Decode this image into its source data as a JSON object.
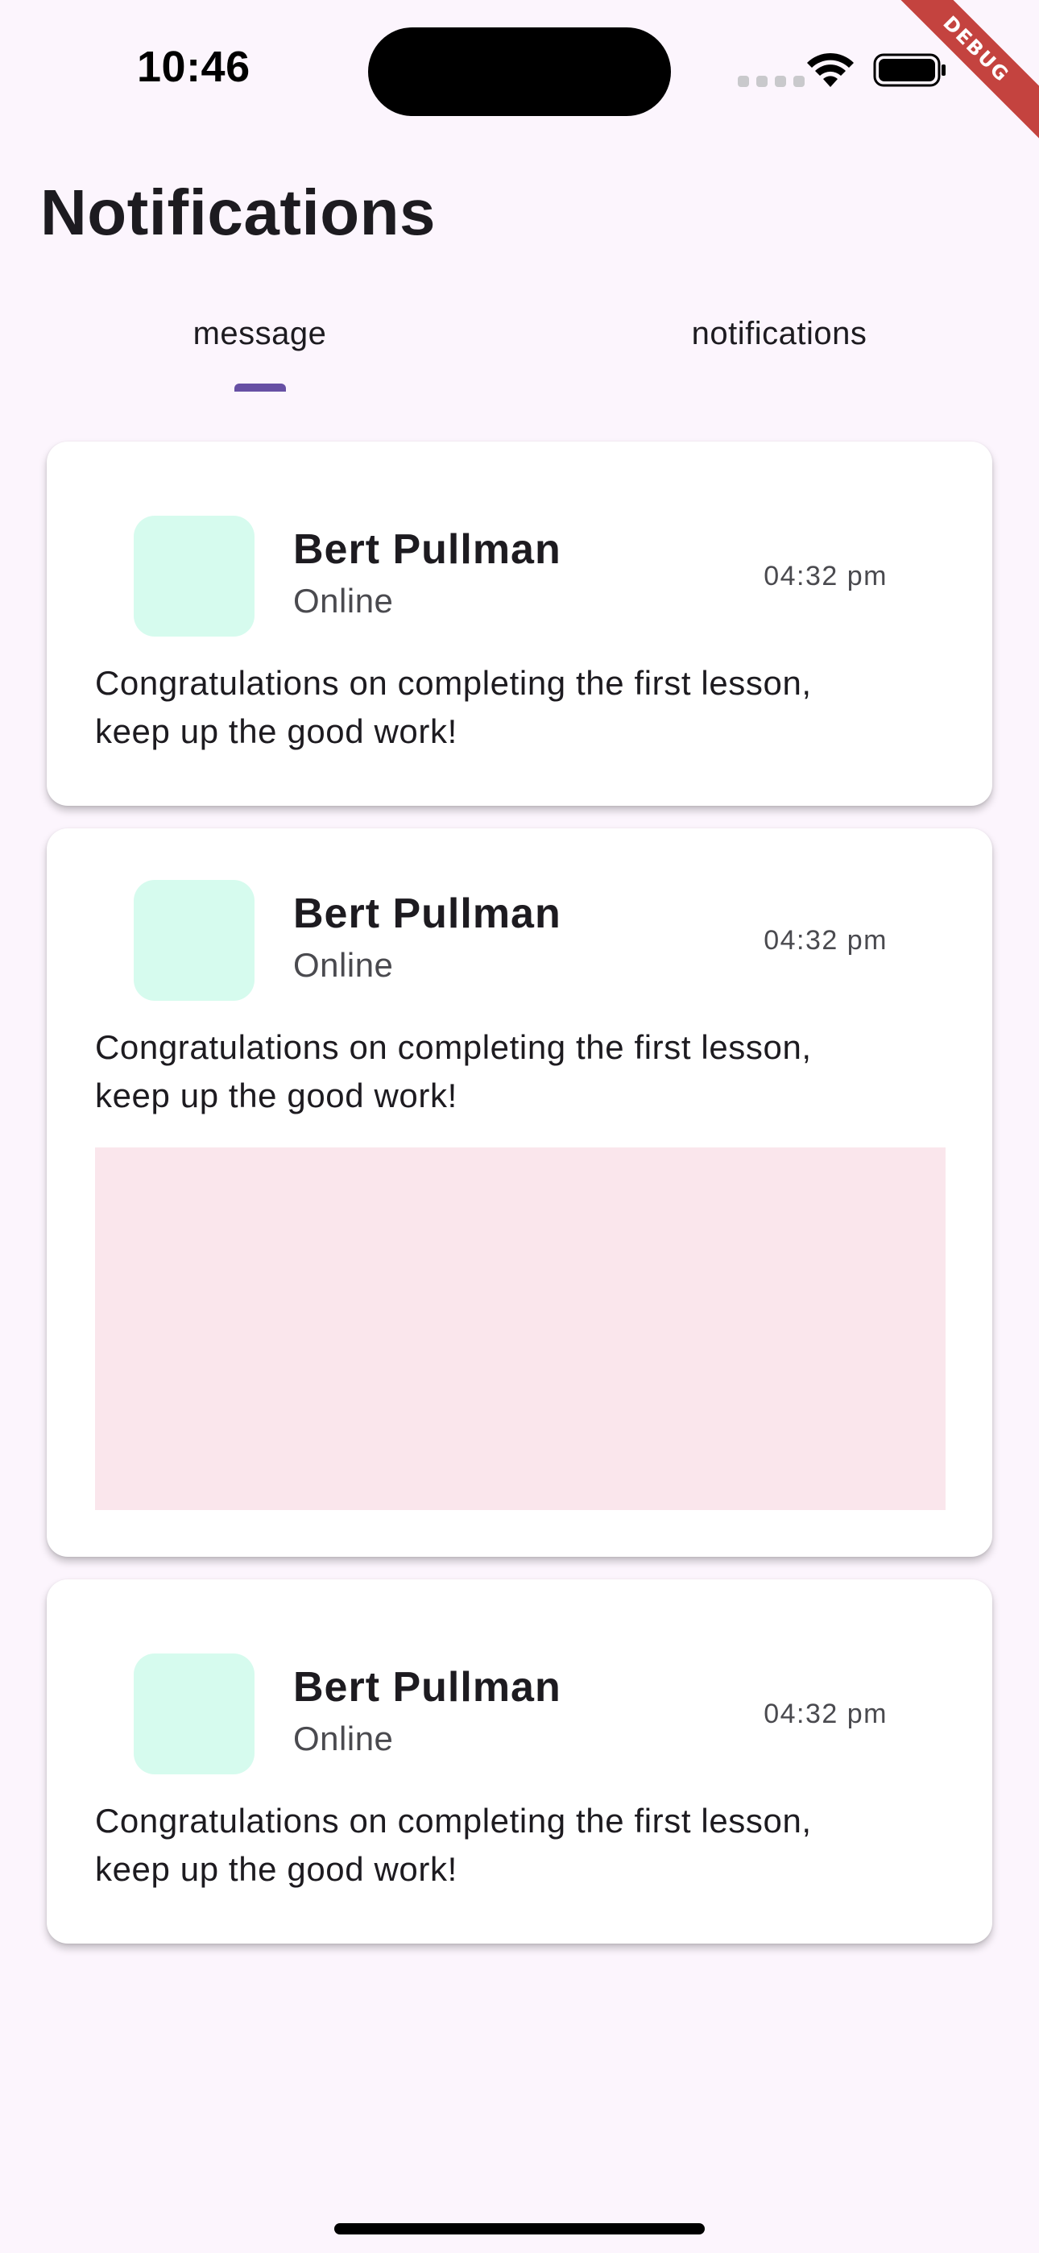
{
  "status_bar": {
    "time": "10:46",
    "icons": [
      "signal-icon",
      "wifi-icon",
      "battery-icon"
    ]
  },
  "debug_banner": "DEBUG",
  "page": {
    "title": "Notifications"
  },
  "tabs": [
    {
      "label": "message",
      "selected": true
    },
    {
      "label": "notifications",
      "selected": false
    }
  ],
  "messages": [
    {
      "name": "Bert Pullman",
      "status": "Online",
      "time": "04:32 pm",
      "body": "Congratulations on completing the first lesson,\nkeep up the good work!",
      "has_image": false
    },
    {
      "name": "Bert Pullman",
      "status": "Online",
      "time": "04:32 pm",
      "body": "Congratulations on completing the first lesson,\nkeep up the good work!",
      "has_image": true
    },
    {
      "name": "Bert Pullman",
      "status": "Online",
      "time": "04:32 pm",
      "body": "Congratulations on completing the first lesson,\nkeep up the good work!",
      "has_image": false
    }
  ],
  "colors": {
    "background": "#fcf5fd",
    "accent": "#6750a4",
    "avatar": "#d6fbee",
    "image_placeholder": "#fae6ec",
    "debug_ribbon": "#c4433f"
  }
}
